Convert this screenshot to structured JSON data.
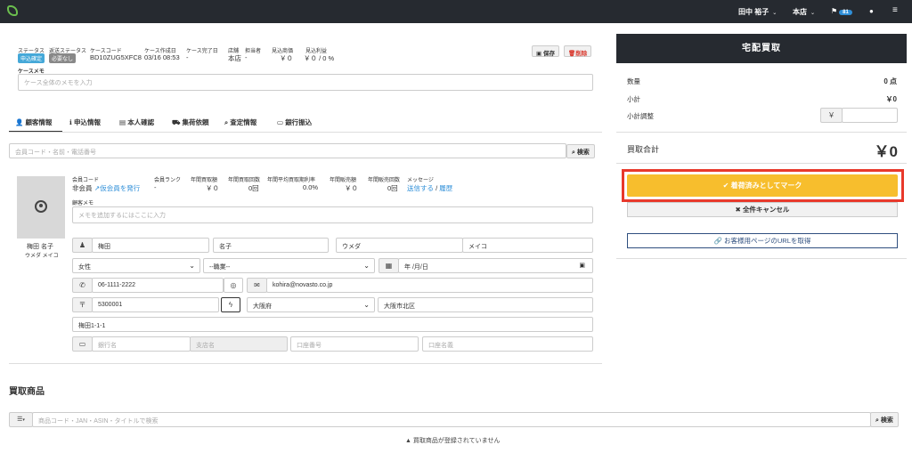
{
  "topbar": {
    "user": "田中 裕子",
    "store": "本店",
    "notif_count": "81",
    "chat_icon": "chat-icon",
    "menu_icon": "hamburger-icon"
  },
  "case": {
    "headers": {
      "status": "ステータス",
      "return_status": "返送ステータス",
      "case_code": "ケースコード",
      "created": "ケース作成日",
      "completed": "ケース完了日",
      "store": "店舗",
      "staff": "担当者",
      "est_price": "見込商価",
      "est_profit": "見込利益"
    },
    "status_tag": "申込確定",
    "return_tag": "必要なし",
    "case_code": "BD10ZUG5XFC8",
    "created": "03/16 08:53",
    "completed": "-",
    "store": "本店",
    "staff": "-",
    "est_price": "￥０",
    "est_profit": "￥０ / 0 %",
    "save_button": "保存",
    "delete_button": "削除",
    "memo_label": "ケースメモ",
    "memo_placeholder": "ケース全体のメモを入力"
  },
  "tabs": [
    {
      "label": "顧客情報",
      "icon": "user-icon"
    },
    {
      "label": "申込情報",
      "icon": "info-icon"
    },
    {
      "label": "本人確認",
      "icon": "id-card-icon"
    },
    {
      "label": "集荷依頼",
      "icon": "truck-icon"
    },
    {
      "label": "査定情報",
      "icon": "search-icon"
    },
    {
      "label": "銀行振込",
      "icon": "bank-icon"
    }
  ],
  "customer_search": {
    "placeholder": "会員コード・名前・電話番号",
    "button": "検索"
  },
  "customer": {
    "headers": {
      "member_code": "会員コード",
      "rank": "会員ランク",
      "annual_amount": "年間買取額",
      "annual_count": "年間買取回数",
      "avg_rate": "年間平均買取期利率",
      "sales_amount": "年間販売額",
      "sales_count": "年間販売回数",
      "message": "メッセージ"
    },
    "member_code": "非会員",
    "issue_temp_link": "仮会員を発行",
    "rank": "-",
    "annual_amount": "￥０",
    "annual_count": "0回",
    "avg_rate": "0.0%",
    "sales_amount": "￥０",
    "sales_count": "0回",
    "send_link": "送信する",
    "history_link": "履歴",
    "memo_label": "顧客メモ",
    "memo_placeholder": "メモを追加するにはここに入力",
    "display_name": "梅田 名子",
    "display_kana": "ウメダ メイコ",
    "last_name": "梅田",
    "first_name": "名子",
    "last_kana": "ウメダ",
    "first_kana": "メイコ",
    "gender": "女性",
    "occupation": "--職業--",
    "birthday_placeholder": "年 /月/日",
    "phone": "06-1111-2222",
    "email": "kohira@novasto.co.jp",
    "postal": "5300001",
    "prefecture": "大阪府",
    "city": "大阪市北区",
    "address": "梅田1-1-1",
    "bank_placeholder": "銀行名",
    "branch_placeholder": "支店名",
    "account_no_placeholder": "口座番号",
    "account_name_placeholder": "口座名義"
  },
  "products": {
    "title": "買取商品",
    "search_placeholder": "商品コード・JAN・ASIN・タイトルで検索",
    "search_button": "検索",
    "empty": "買取商品が登録されていません"
  },
  "summary": {
    "title": "宅配買取",
    "qty_label": "数量",
    "qty_value": "0 点",
    "subtotal_label": "小計",
    "subtotal_value": "￥0",
    "adjust_label": "小計調整",
    "adjust_currency": "￥",
    "total_label": "買取合計",
    "total_value": "￥0",
    "mark_button": "着荷済みとしてマーク",
    "cancel_button": "全件キャンセル",
    "url_button": "お客様用ページのURLを取得"
  },
  "colors": {
    "topbar": "#262a30",
    "accent_yellow": "#f7be2d",
    "highlight_red": "#e8392b",
    "status_blue": "#45a8d8",
    "link_blue": "#2f8fd8"
  }
}
